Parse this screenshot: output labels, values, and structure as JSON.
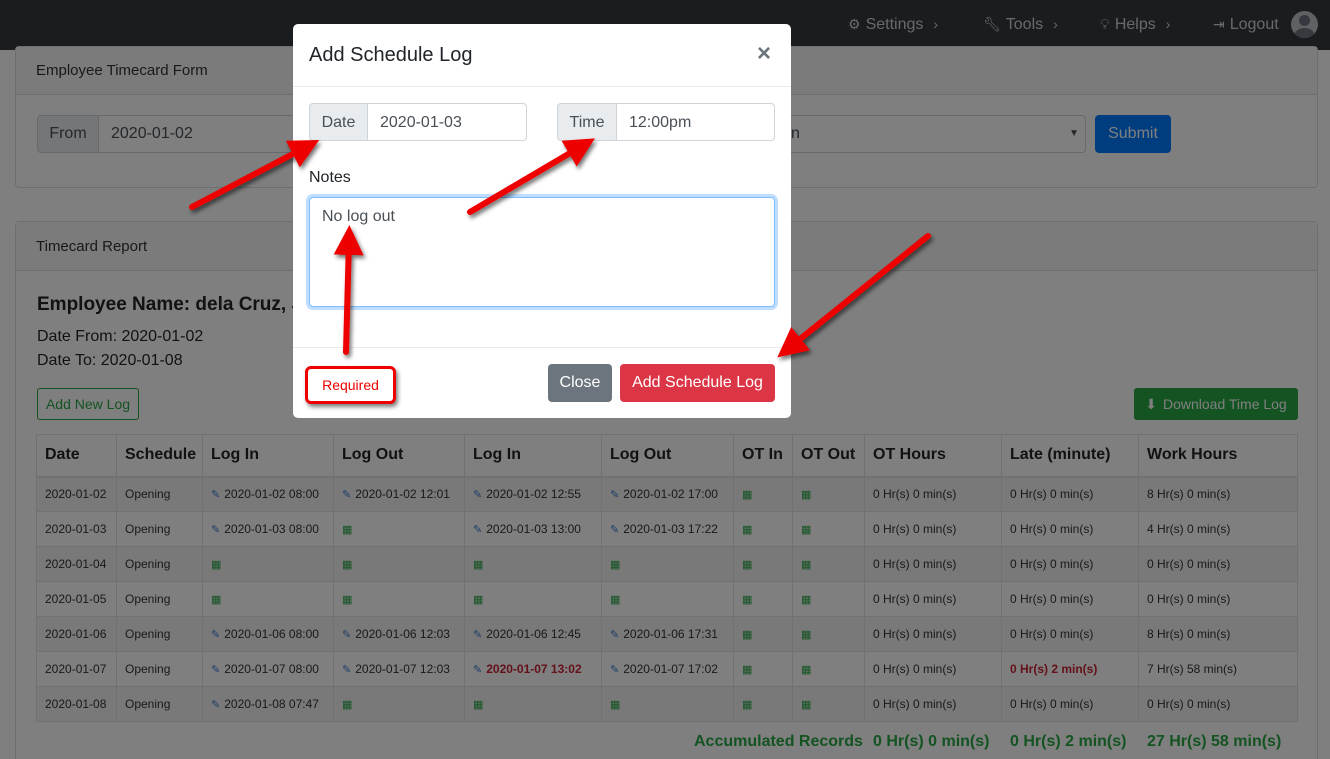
{
  "nav": {
    "settings": "Settings",
    "tools": "Tools",
    "helps": "Helps",
    "logout": "Logout"
  },
  "form_card": {
    "title": "Employee Timecard Form",
    "from_label": "From",
    "from_value": "2020-01-02",
    "select_partial": "n",
    "submit": "Submit"
  },
  "report_card": {
    "title": "Timecard Report",
    "employee_name": "Employee Name: dela Cruz, J",
    "date_from": "Date From: 2020-01-02",
    "date_to": "Date To: 2020-01-08",
    "add_new_log": "Add New Log",
    "download": "Download Time Log"
  },
  "table": {
    "headers": [
      "Date",
      "Schedule",
      "Log In",
      "Log Out",
      "Log In",
      "Log Out",
      "OT In",
      "OT Out",
      "OT Hours",
      "Late (minute)",
      "Work Hours"
    ],
    "rows": [
      [
        "2020-01-02",
        "Opening",
        "2020-01-02 08:00",
        "2020-01-02 12:01",
        "2020-01-02 12:55",
        "2020-01-02 17:00",
        "",
        "",
        "0 Hr(s) 0 min(s)",
        "0 Hr(s) 0 min(s)",
        "8 Hr(s) 0 min(s)"
      ],
      [
        "2020-01-03",
        "Opening",
        "2020-01-03 08:00",
        "",
        "2020-01-03 13:00",
        "2020-01-03 17:22",
        "",
        "",
        "0 Hr(s) 0 min(s)",
        "0 Hr(s) 0 min(s)",
        "4 Hr(s) 0 min(s)"
      ],
      [
        "2020-01-04",
        "Opening",
        "",
        "",
        "",
        "",
        "",
        "",
        "0 Hr(s) 0 min(s)",
        "0 Hr(s) 0 min(s)",
        "0 Hr(s) 0 min(s)"
      ],
      [
        "2020-01-05",
        "Opening",
        "",
        "",
        "",
        "",
        "",
        "",
        "0 Hr(s) 0 min(s)",
        "0 Hr(s) 0 min(s)",
        "0 Hr(s) 0 min(s)"
      ],
      [
        "2020-01-06",
        "Opening",
        "2020-01-06 08:00",
        "2020-01-06 12:03",
        "2020-01-06 12:45",
        "2020-01-06 17:31",
        "",
        "",
        "0 Hr(s) 0 min(s)",
        "0 Hr(s) 0 min(s)",
        "8 Hr(s) 0 min(s)"
      ],
      [
        "2020-01-07",
        "Opening",
        "2020-01-07 08:00",
        "2020-01-07 12:03",
        "2020-01-07 13:02",
        "2020-01-07 17:02",
        "",
        "",
        "0 Hr(s) 0 min(s)",
        "0 Hr(s) 2 min(s)",
        "7 Hr(s) 58 min(s)"
      ],
      [
        "2020-01-08",
        "Opening",
        "2020-01-08 07:47",
        "",
        "",
        "",
        "",
        "",
        "0 Hr(s) 0 min(s)",
        "0 Hr(s) 0 min(s)",
        "0 Hr(s) 0 min(s)"
      ]
    ],
    "accumulated_label": "Accumulated Records",
    "accumulated_ot": "0 Hr(s) 0 min(s)",
    "accumulated_late": "0 Hr(s) 2 min(s)",
    "accumulated_work": "27 Hr(s) 58 min(s)"
  },
  "modal": {
    "title": "Add Schedule Log",
    "close_x": "×",
    "date_label": "Date",
    "date_value": "2020-01-03",
    "time_label": "Time",
    "time_value": "12:00pm",
    "notes_label": "Notes",
    "notes_value": "No log out",
    "required": "Required",
    "close_button": "Close",
    "add_button": "Add Schedule Log"
  },
  "colors": {
    "primary": "#007bff",
    "success": "#28a745",
    "danger": "#dc3545",
    "navbar": "#343a40",
    "annotation": "#ee0000"
  }
}
